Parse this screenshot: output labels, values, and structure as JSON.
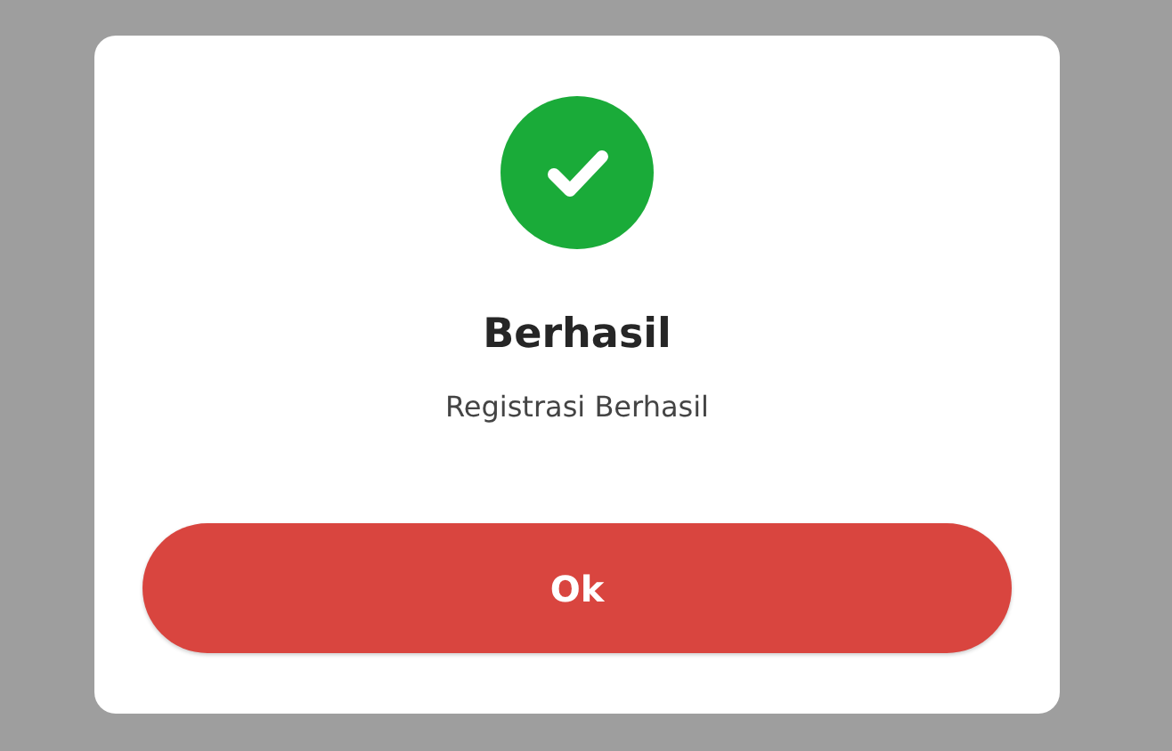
{
  "dialog": {
    "title": "Berhasil",
    "message": "Registrasi Berhasil",
    "kind": "success",
    "buttons": [
      {
        "label": "Ok"
      }
    ]
  }
}
